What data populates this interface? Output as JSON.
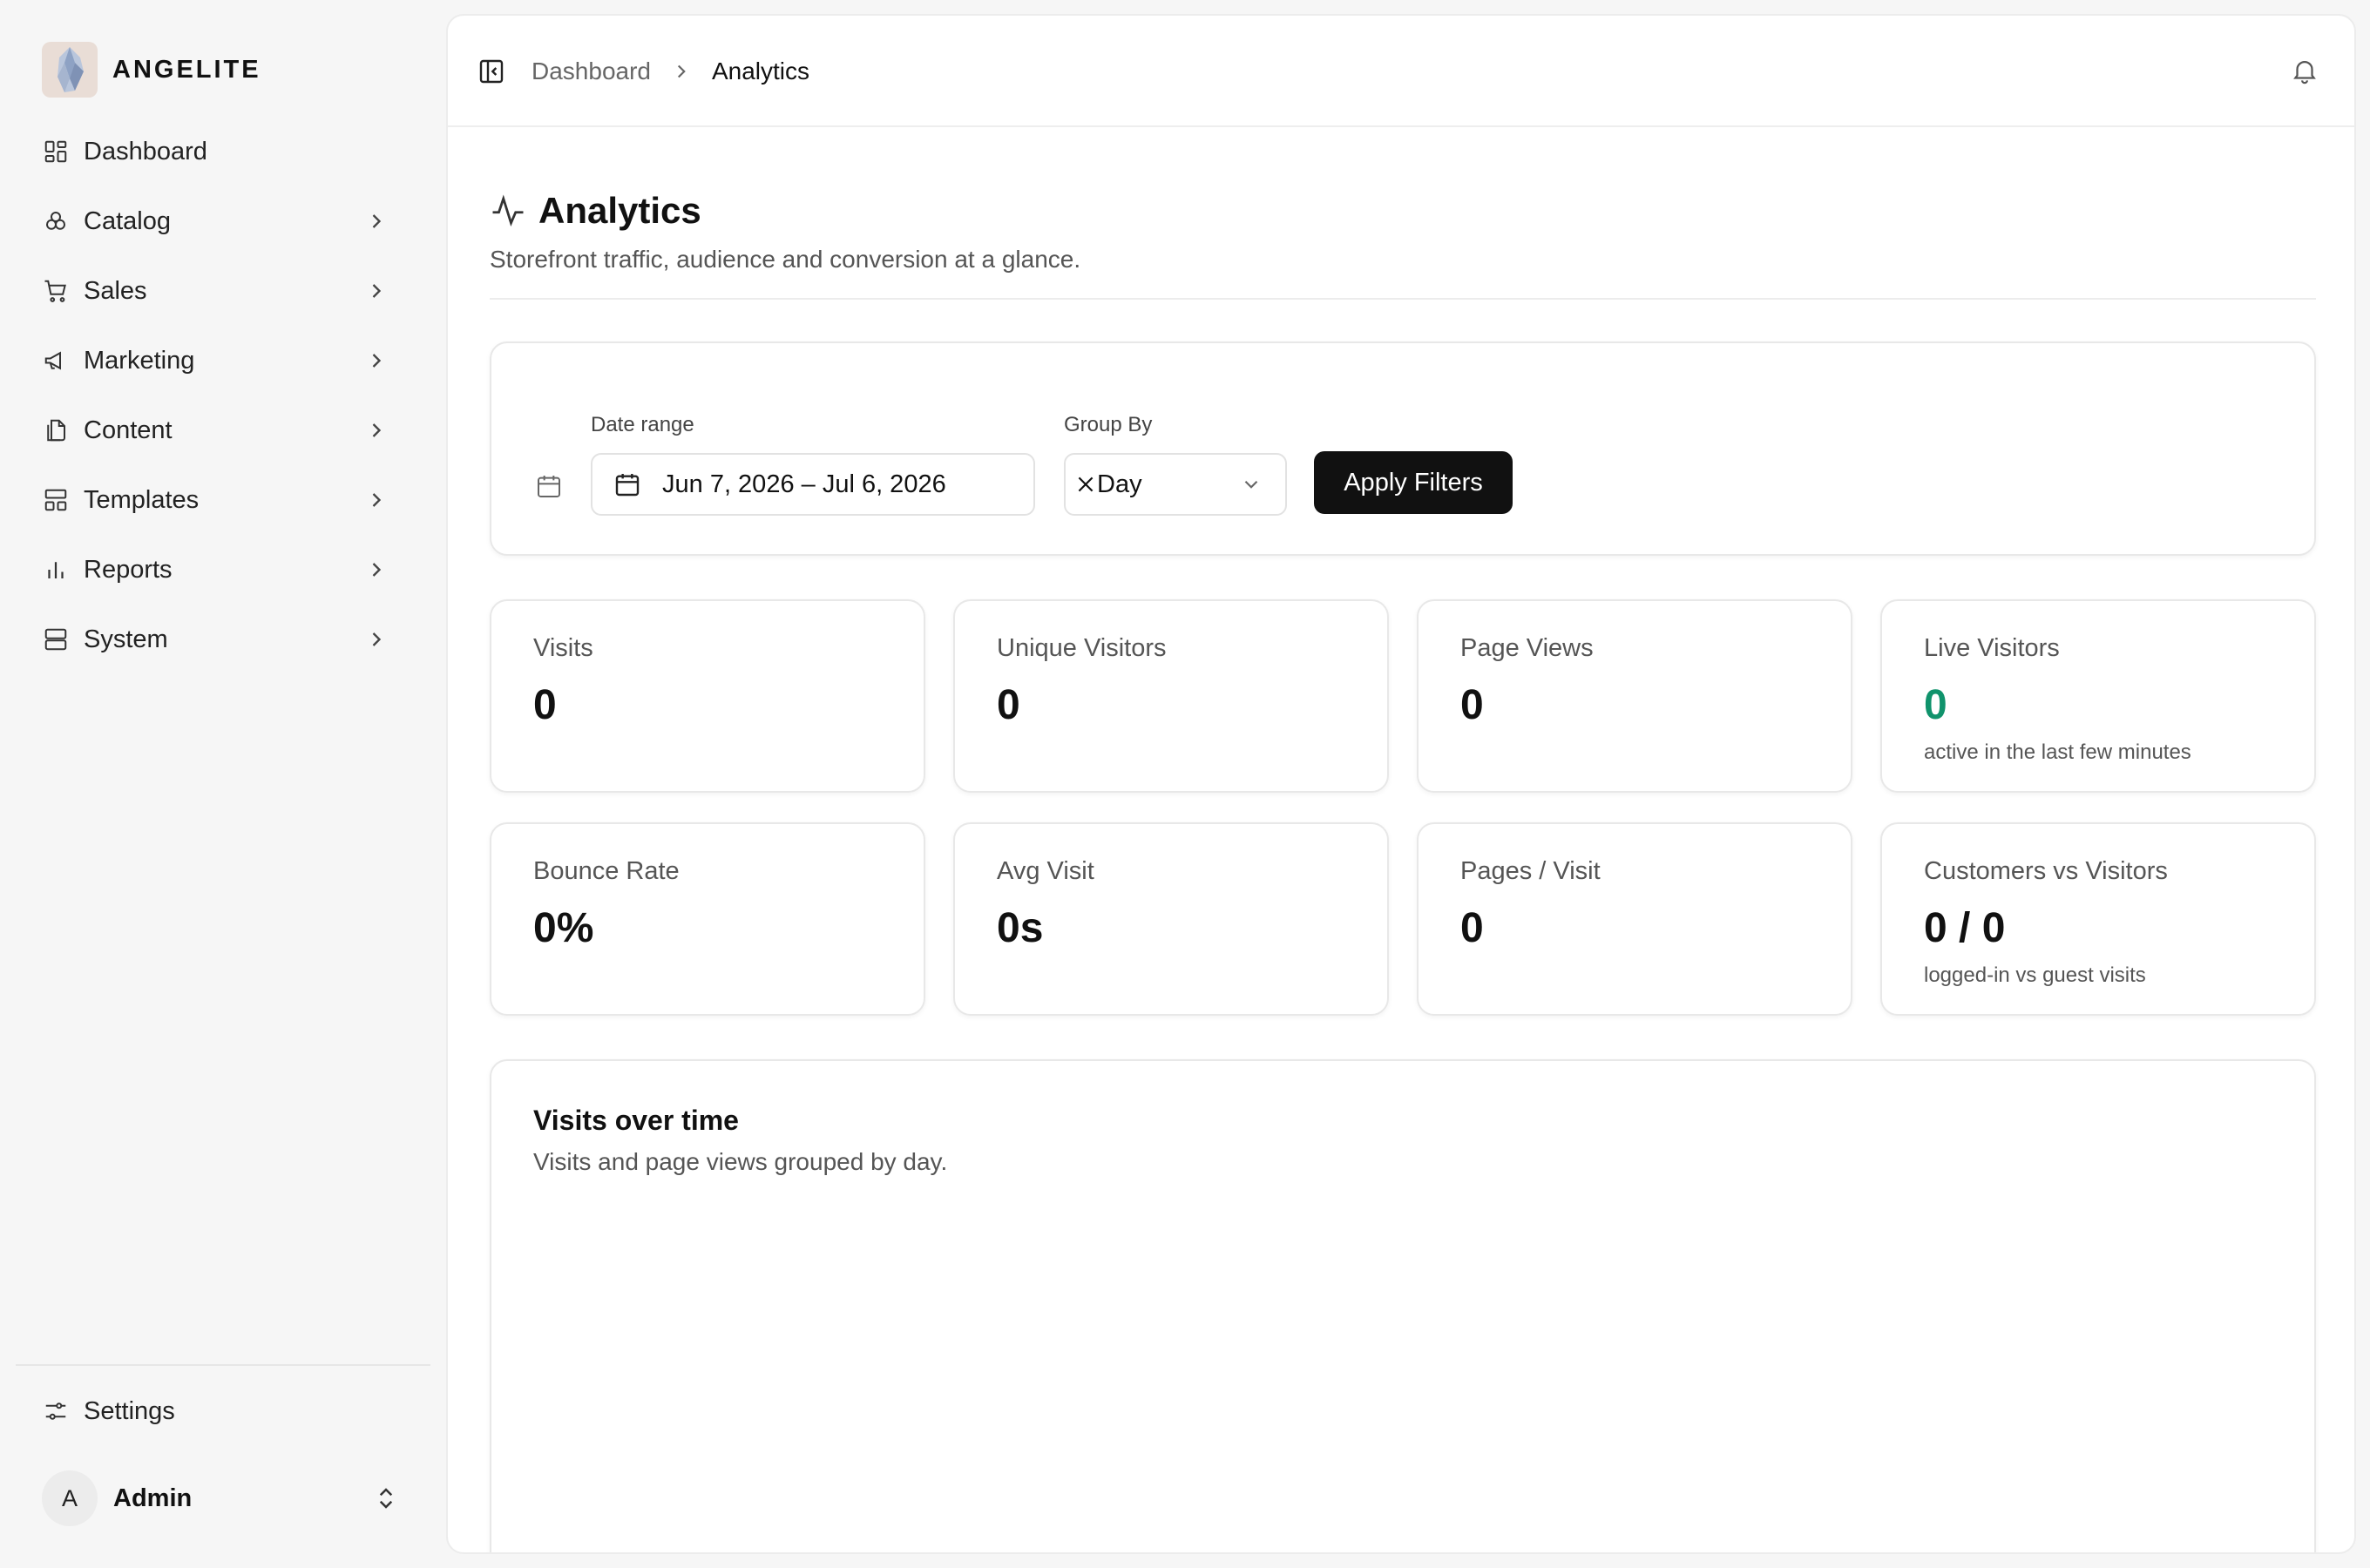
{
  "brand": {
    "name": "ANGELITE"
  },
  "sidebar": {
    "items": [
      {
        "label": "Dashboard",
        "icon": "dashboard-icon",
        "has_children": false
      },
      {
        "label": "Catalog",
        "icon": "catalog-icon",
        "has_children": true
      },
      {
        "label": "Sales",
        "icon": "cart-icon",
        "has_children": true
      },
      {
        "label": "Marketing",
        "icon": "megaphone-icon",
        "has_children": true
      },
      {
        "label": "Content",
        "icon": "files-icon",
        "has_children": true
      },
      {
        "label": "Templates",
        "icon": "layout-icon",
        "has_children": true
      },
      {
        "label": "Reports",
        "icon": "bar-chart-icon",
        "has_children": true
      },
      {
        "label": "System",
        "icon": "server-icon",
        "has_children": true
      }
    ],
    "settings_label": "Settings",
    "user": {
      "initial": "A",
      "name": "Admin"
    }
  },
  "topbar": {
    "breadcrumb": [
      "Dashboard",
      "Analytics"
    ]
  },
  "page": {
    "title": "Analytics",
    "subtitle": "Storefront traffic, audience and conversion at a glance."
  },
  "filters": {
    "date_range_label": "Date range",
    "date_range_value": "Jun 7, 2026 – Jul 6, 2026",
    "group_by_label": "Group By",
    "group_by_value": "Day",
    "apply_label": "Apply Filters"
  },
  "stats": {
    "visits": {
      "label": "Visits",
      "value": "0"
    },
    "unique_visitors": {
      "label": "Unique Visitors",
      "value": "0"
    },
    "page_views": {
      "label": "Page Views",
      "value": "0"
    },
    "live_visitors": {
      "label": "Live Visitors",
      "value": "0",
      "note": "active in the last few minutes",
      "color": "#10936c"
    },
    "bounce_rate": {
      "label": "Bounce Rate",
      "value": "0%"
    },
    "avg_visit": {
      "label": "Avg Visit",
      "value": "0s"
    },
    "pages_per_visit": {
      "label": "Pages / Visit",
      "value": "0"
    },
    "customers_vs_visitors": {
      "label": "Customers vs Visitors",
      "value": "0 / 0",
      "note": "logged-in vs guest visits"
    }
  },
  "chart": {
    "title": "Visits over time",
    "subtitle": "Visits and page views grouped by day."
  }
}
